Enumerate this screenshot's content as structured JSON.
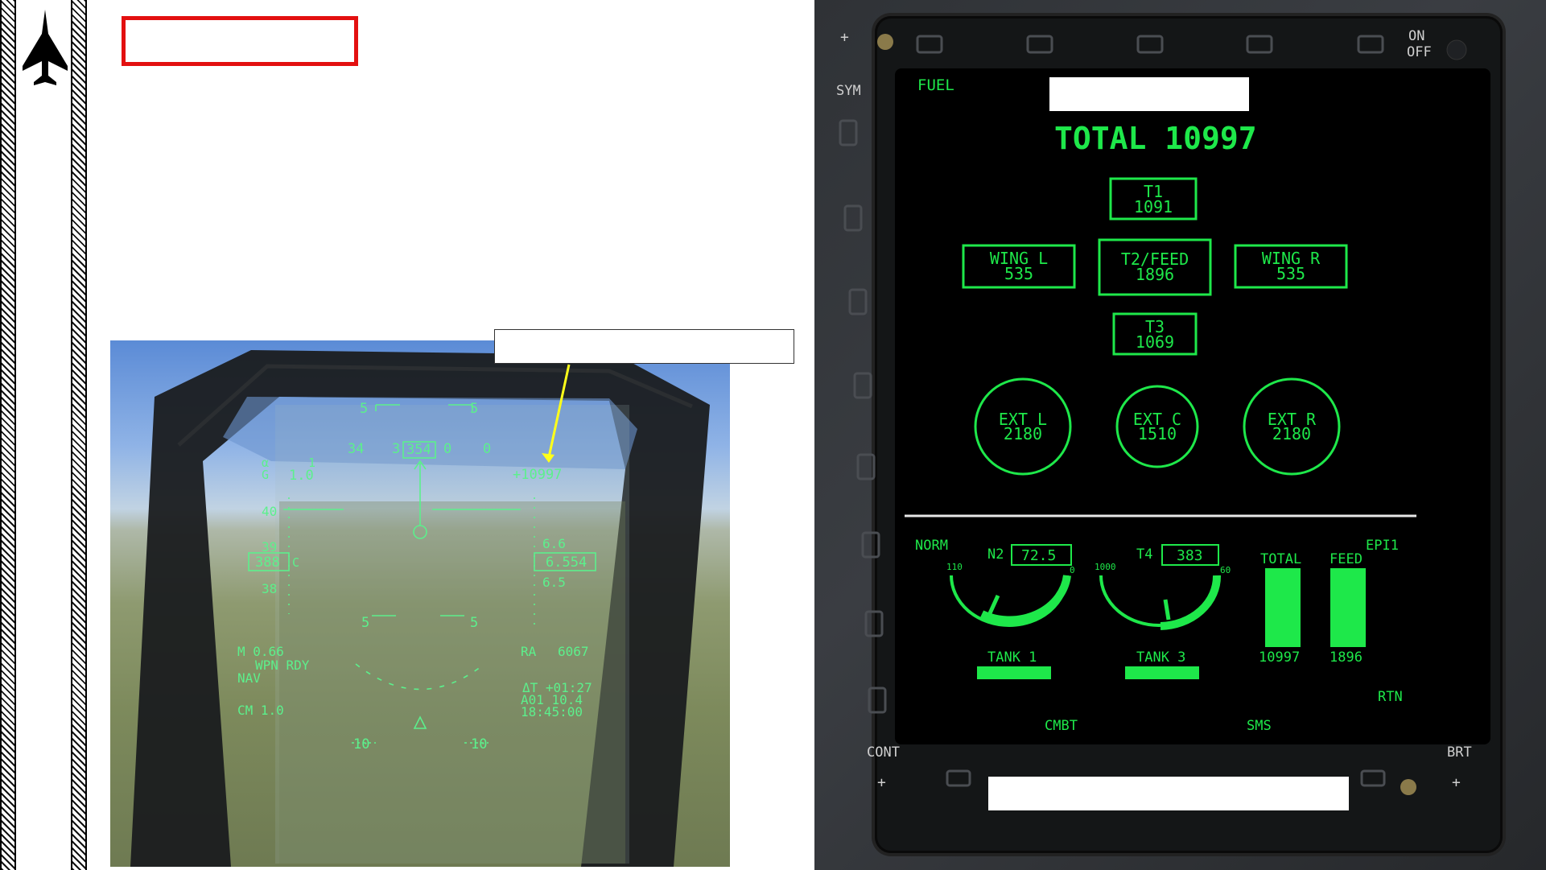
{
  "hud": {
    "heading_ticks": [
      "34",
      "3",
      "354",
      "0",
      "0"
    ],
    "pitch_top_left": "5",
    "pitch_top_right": "5",
    "pitch_bottom_left": "5",
    "pitch_bottom_right": "5",
    "pitch_low_left": "10",
    "pitch_low_right": "10",
    "alpha_label": "α",
    "g_label": "G",
    "alpha_value": "1",
    "g_value": "1.0",
    "fuel_readout": "+10997",
    "airspeed_box": "388",
    "airspeed_ticks": [
      "40",
      "39",
      "38"
    ],
    "airspeed_suffix": "C",
    "altitude_box": "6.554",
    "altitude_ticks": [
      "6.6",
      "6.5"
    ],
    "mach": "M 0.66",
    "weapon_status": "WPN RDY",
    "mode": "NAV",
    "cm": "CM 1.0",
    "radar_alt_label": "RA",
    "radar_alt_value": "6067",
    "delta_t": "ΔT +01:27",
    "waypoint": "A01 10.4",
    "clock": "18:45:00"
  },
  "mfd": {
    "page_label": "FUEL",
    "total_label": "TOTAL 10997",
    "osb_left": [
      "SYM",
      "CONT"
    ],
    "osb_right_top": [
      "ON",
      "OFF"
    ],
    "osb_right_bottom": "BRT",
    "tanks": [
      {
        "name": "T1",
        "value": "1091"
      },
      {
        "name": "WING L",
        "value": "535"
      },
      {
        "name": "T2/FEED",
        "value": "1896"
      },
      {
        "name": "WING R",
        "value": "535"
      },
      {
        "name": "T3",
        "value": "1069"
      }
    ],
    "external_tanks": [
      {
        "name": "EXT L",
        "value": "2180"
      },
      {
        "name": "EXT C",
        "value": "1510"
      },
      {
        "name": "EXT R",
        "value": "2180"
      }
    ],
    "engine": {
      "mode": "NORM",
      "epi": "EPI1",
      "n2_label": "N2",
      "n2_value": "72.5",
      "n2_min": "110",
      "n2_max": "0",
      "t4_label": "T4",
      "t4_value": "383",
      "t4_min": "1000",
      "t4_max": "60",
      "total_label": "TOTAL",
      "total_value": "10997",
      "feed_label": "FEED",
      "feed_value": "1896",
      "tank1_label": "TANK 1",
      "tank3_label": "TANK 3",
      "rtn_label": "RTN"
    },
    "bottom_labels": [
      "CMBT",
      "SMS"
    ]
  },
  "colors": {
    "mfd_green": "#1ee84a",
    "hud_green": "#5cf08c",
    "title_box": "#e31010",
    "callout_arrow": "#ffff1a"
  }
}
